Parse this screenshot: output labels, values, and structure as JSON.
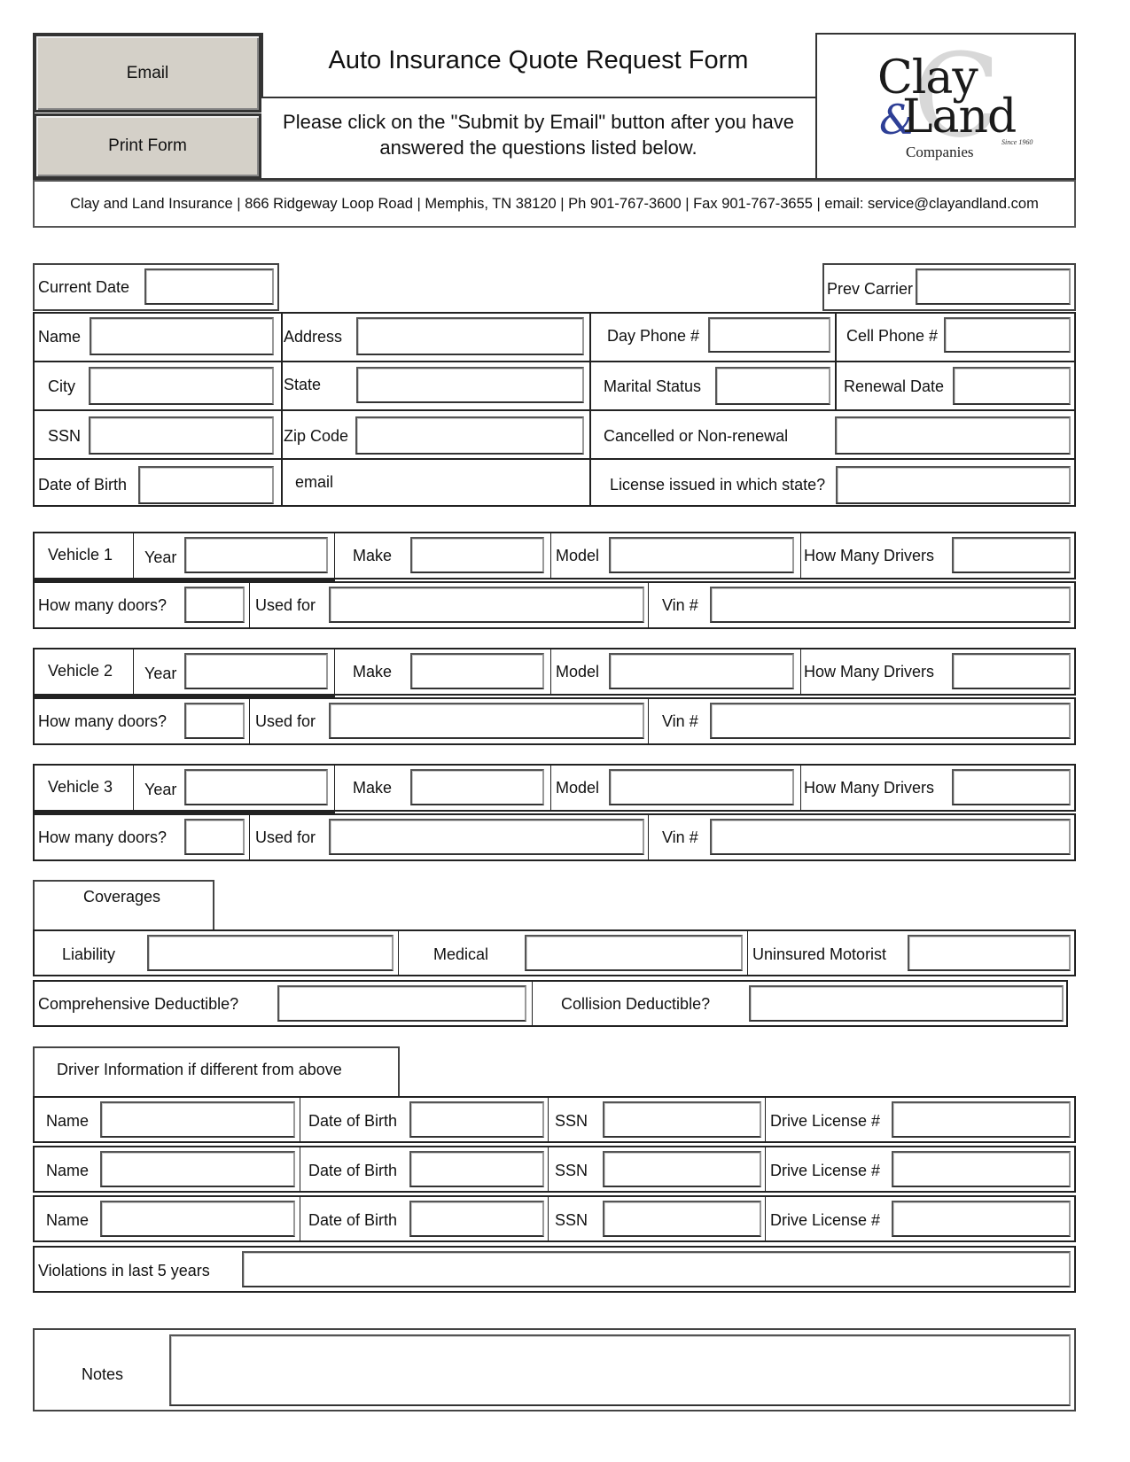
{
  "header": {
    "email_button": "Email",
    "print_button": "Print Form",
    "title": "Auto Insurance Quote Request Form",
    "instructions_line1": "Please click on the \"Submit by Email\" button after you have",
    "instructions_line2": "answered the questions listed below.",
    "contact_line": "Clay and Land Insurance | 866 Ridgeway Loop Road | Memphis, TN 38120 | Ph 901-767-3600 | Fax 901-767-3655 | email: service@clayandland.com"
  },
  "logo": {
    "word1": "Clay",
    "ampersand": "&",
    "word2": "Land",
    "companies": "Companies",
    "since": "Since 1960",
    "watermark": "C",
    "accent_color": "#2e3f96"
  },
  "applicant": {
    "current_date": {
      "label": "Current Date",
      "value": ""
    },
    "prev_carrier": {
      "label": "Prev Carrier",
      "value": ""
    },
    "name": {
      "label": "Name",
      "value": ""
    },
    "address": {
      "label": "Address",
      "value": ""
    },
    "day_phone": {
      "label": "Day Phone #",
      "value": ""
    },
    "cell_phone": {
      "label": "Cell Phone #",
      "value": ""
    },
    "city": {
      "label": "City",
      "value": ""
    },
    "state": {
      "label": "State",
      "value": ""
    },
    "marital_status": {
      "label": "Marital Status",
      "value": ""
    },
    "renewal_date": {
      "label": "Renewal Date",
      "value": ""
    },
    "ssn": {
      "label": "SSN",
      "value": ""
    },
    "zip": {
      "label": "Zip Code",
      "value": ""
    },
    "cancelled": {
      "label": "Cancelled or Non-renewal",
      "value": ""
    },
    "dob": {
      "label": "Date of Birth",
      "value": ""
    },
    "email": {
      "label": "email"
    },
    "license_state": {
      "label": "License issued in which state?",
      "value": ""
    }
  },
  "vehicles": [
    {
      "title": "Vehicle 1",
      "year": "Year",
      "make": "Make",
      "model": "Model",
      "drivers": "How Many Drivers",
      "doors": "How many doors?",
      "used_for": "Used for",
      "vin": "Vin #"
    },
    {
      "title": "Vehicle 2",
      "year": "Year",
      "make": "Make",
      "model": "Model",
      "drivers": "How Many Drivers",
      "doors": "How many doors?",
      "used_for": "Used for",
      "vin": "Vin #"
    },
    {
      "title": "Vehicle 3",
      "year": "Year",
      "make": "Make",
      "model": "Model",
      "drivers": "How Many Drivers",
      "doors": "How many doors?",
      "used_for": "Used for",
      "vin": "Vin #"
    }
  ],
  "coverages": {
    "title": "Coverages",
    "liability": "Liability",
    "medical": "Medical",
    "uninsured": "Uninsured Motorist",
    "comprehensive": "Comprehensive Deductible?",
    "collision": "Collision Deductible?"
  },
  "drivers": {
    "title": "Driver Information if different from above",
    "rows": [
      {
        "name": "Name",
        "dob": "Date of Birth",
        "ssn": "SSN",
        "license": "Drive License #"
      },
      {
        "name": "Name",
        "dob": "Date of Birth",
        "ssn": "SSN",
        "license": "Drive License #"
      },
      {
        "name": "Name",
        "dob": "Date of Birth",
        "ssn": "SSN",
        "license": "Drive License #"
      }
    ],
    "violations": "Violations in last 5 years"
  },
  "notes": {
    "label": "Notes"
  }
}
